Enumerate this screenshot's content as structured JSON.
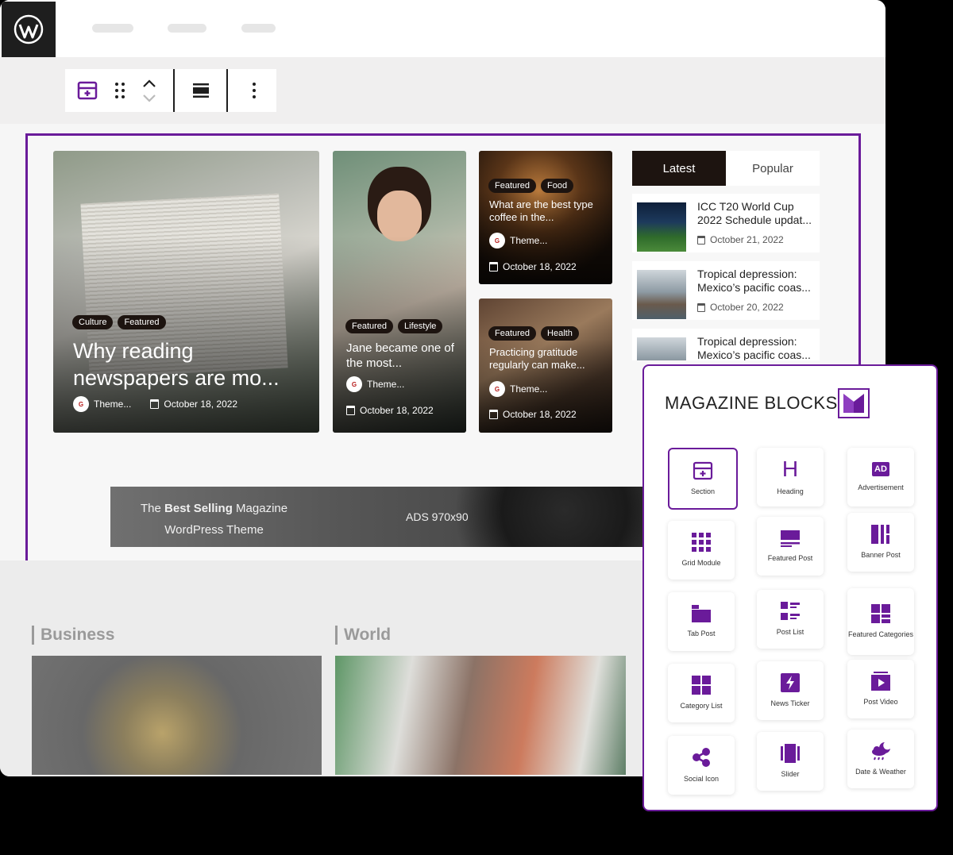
{
  "toolbar": {
    "items": [
      "section-block-icon",
      "drag-handle-icon",
      "move-up-down-icon",
      "align-icon",
      "more-options-icon"
    ]
  },
  "featured_cards": [
    {
      "tags": [
        "Culture",
        "Featured"
      ],
      "title": "Why reading newspapers are mo...",
      "author": "Theme...",
      "date": "October 18, 2022"
    },
    {
      "tags": [
        "Featured",
        "Lifestyle"
      ],
      "title": "Jane became one of the most...",
      "author": "Theme...",
      "date": "October 18, 2022"
    },
    {
      "tags": [
        "Featured",
        "Food"
      ],
      "title": "What are the best type coffee in the...",
      "author": "Theme...",
      "date": "October 18, 2022"
    },
    {
      "tags": [
        "Featured",
        "Health"
      ],
      "title": "Practicing gratitude regularly can make...",
      "author": "Theme...",
      "date": "October 18, 2022"
    }
  ],
  "sidebar_tabs": {
    "latest": "Latest",
    "popular": "Popular"
  },
  "sidebar_list": [
    {
      "title": "ICC T20 World Cup 2022 Schedule updat...",
      "date": "October 21, 2022"
    },
    {
      "title": "Tropical depression: Mexico’s pacific coas...",
      "date": "October 20, 2022"
    },
    {
      "title": "Tropical depression: Mexico’s pacific coas...",
      "date": ""
    }
  ],
  "ad": {
    "line1_pre": "The ",
    "line1_bold": "Best Selling",
    "line1_post": " Magazine",
    "line2": "WordPress Theme",
    "size": "ADS 970x90"
  },
  "categories": {
    "business": "Business",
    "world": "World"
  },
  "panel": {
    "title": "MAGAZINE BLOCKS",
    "blocks": [
      {
        "label": "Section",
        "icon": "section-icon"
      },
      {
        "label": "Heading",
        "icon": "heading-icon"
      },
      {
        "label": "Advertisement",
        "icon": "ad-icon"
      },
      {
        "label": "Grid Module",
        "icon": "grid-icon"
      },
      {
        "label": "Featured Post",
        "icon": "featured-post-icon"
      },
      {
        "label": "Banner Post",
        "icon": "banner-post-icon"
      },
      {
        "label": "Tab Post",
        "icon": "tab-post-icon"
      },
      {
        "label": "Post List",
        "icon": "post-list-icon"
      },
      {
        "label": "Featured Categories",
        "icon": "featured-categories-icon"
      },
      {
        "label": "Category List",
        "icon": "category-list-icon"
      },
      {
        "label": "News Ticker",
        "icon": "news-ticker-icon"
      },
      {
        "label": "Post Video",
        "icon": "post-video-icon"
      },
      {
        "label": "Social Icon",
        "icon": "social-icon"
      },
      {
        "label": "Slider",
        "icon": "slider-icon"
      },
      {
        "label": "Date & Weather",
        "icon": "weather-icon"
      }
    ],
    "ad_badge": "AD",
    "heading_glyph": "H"
  },
  "colors": {
    "accent": "#6a1b9a",
    "tab_active": "#1d1410"
  }
}
